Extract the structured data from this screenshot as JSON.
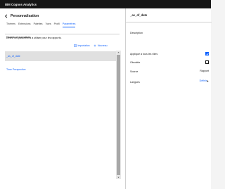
{
  "app": {
    "title": "IBM Cognos Analytics"
  },
  "left": {
    "title": "Personnalisation",
    "tabs": [
      "Thèmes",
      "Extensions",
      "Palettes",
      "Vues",
      "Profil",
      "Paramètres"
    ],
    "tabs_row2": [
      "Visuels personnalisés"
    ],
    "active_tab": "Paramètres",
    "description": "Définir les paramètres à utiliser pour les rapports.",
    "actions": {
      "import_label": "Importation",
      "new_label": "Nouveau"
    },
    "parameters": [
      "_as_of_date",
      "Time Perspective"
    ]
  },
  "right": {
    "title": "_as_of_date",
    "description_label": "Description",
    "applied_label": "Appliqué à tous les rôles",
    "applied_checked": true,
    "required_label": "Obsolète",
    "required_checked": false,
    "source_label": "Source",
    "source_value": "Rapport",
    "languages_label": "Langues",
    "languages_link": "Définir"
  },
  "colors": {
    "accent": "#0f62fe",
    "topbar": "#161616",
    "selected_row": "#e0e0e0"
  },
  "icons": [
    "chevron-left-icon",
    "import-icon",
    "plus-icon",
    "checkmark-icon",
    "caret-up-icon",
    "caret-down-icon",
    "caret-right-icon"
  ]
}
